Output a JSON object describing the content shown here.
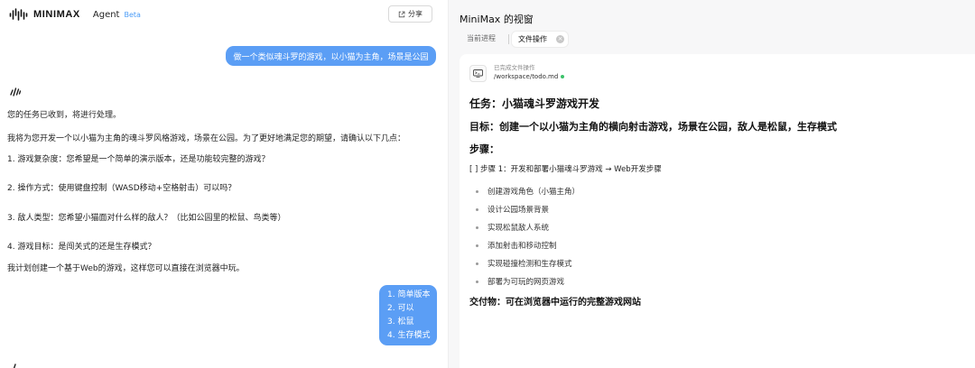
{
  "header": {
    "brand": "MINIMAX",
    "agent": "Agent",
    "beta": "Beta",
    "share_label": "分享"
  },
  "chat": {
    "user_message_1": "做一个类似魂斗罗的游戏，以小猫为主角，场景是公园",
    "ai_lines": [
      "您的任务已收到，将进行处理。",
      "我将为您开发一个以小猫为主角的魂斗罗风格游戏，场景在公园。为了更好地满足您的期望，请确认以下几点：",
      "1. 游戏复杂度：您希望是一个简单的演示版本，还是功能较完整的游戏？",
      "2. 操作方式：使用键盘控制（WASD移动+空格射击）可以吗？",
      "3. 敌人类型：您希望小猫面对什么样的敌人？（比如公园里的松鼠、鸟类等）",
      "4. 游戏目标：是闯关式的还是生存模式？",
      "我计划创建一个基于Web的游戏，这样您可以直接在浏览器中玩。"
    ],
    "user_message_2": [
      "1. 简单版本",
      "2. 可以",
      "3. 松鼠",
      "4. 生存模式"
    ]
  },
  "window": {
    "title": "MiniMax 的视窗",
    "tabs": [
      "当前进程",
      "文件操作"
    ],
    "operation_label": "已完成文件操作",
    "file_path": "/workspace/todo.md",
    "status_color": "#3cc26a",
    "doc": {
      "task": "任务：小猫魂斗罗游戏开发",
      "goal": "目标：创建一个以小猫为主角的横向射击游戏，场景在公园，敌人是松鼠，生存模式",
      "steps_heading": "步骤：",
      "step1": "[ ] 步骤 1：开发和部署小猫魂斗罗游戏 → Web开发步骤",
      "substeps": [
        "创建游戏角色（小猫主角）",
        "设计公园场景背景",
        "实现松鼠敌人系统",
        "添加射击和移动控制",
        "实现碰撞检测和生存模式",
        "部署为可玩的网页游戏"
      ],
      "deliverable": "交付物：可在浏览器中运行的完整游戏网站"
    }
  },
  "colors": {
    "accent": "#5b9ef5",
    "beta": "#4b9cf7"
  }
}
